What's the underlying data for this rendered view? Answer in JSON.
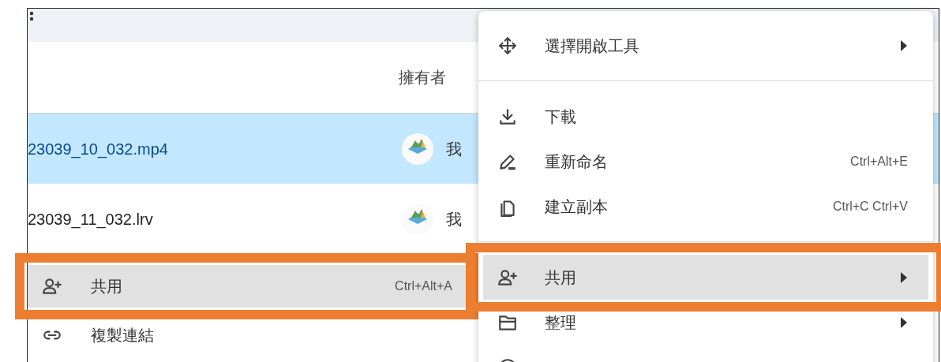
{
  "file_list": {
    "owner_header": "擁有者",
    "rows": [
      {
        "name": "23039_10_032.mp4",
        "owner": "我",
        "selected": true
      },
      {
        "name": "23039_11_032.lrv",
        "owner": "我",
        "selected": false
      }
    ]
  },
  "left_menu": {
    "items": [
      {
        "kind": "share",
        "label": "共用",
        "shortcut": "Ctrl+Alt+A",
        "selected": true,
        "annotated": true
      },
      {
        "kind": "link",
        "label": "複製連結",
        "selected": false,
        "annotated": false
      }
    ]
  },
  "context_menu": {
    "sections": [
      [
        {
          "kind": "open",
          "label": "選擇開啟工具",
          "submenu": true,
          "selected": false,
          "annotated": false
        }
      ],
      [
        {
          "kind": "download",
          "label": "下載",
          "submenu": false,
          "selected": false,
          "annotated": false
        },
        {
          "kind": "rename",
          "label": "重新命名",
          "shortcut": "Ctrl+Alt+E",
          "submenu": false,
          "selected": false,
          "annotated": false
        },
        {
          "kind": "copy",
          "label": "建立副本",
          "shortcut": "Ctrl+C Ctrl+V",
          "submenu": false,
          "selected": false,
          "annotated": false
        }
      ],
      [
        {
          "kind": "share",
          "label": "共用",
          "submenu": true,
          "selected": true,
          "annotated": true
        },
        {
          "kind": "organize",
          "label": "整理",
          "submenu": true,
          "selected": false,
          "annotated": false
        },
        {
          "kind": "info",
          "selected": false,
          "annotated": false
        }
      ]
    ]
  }
}
